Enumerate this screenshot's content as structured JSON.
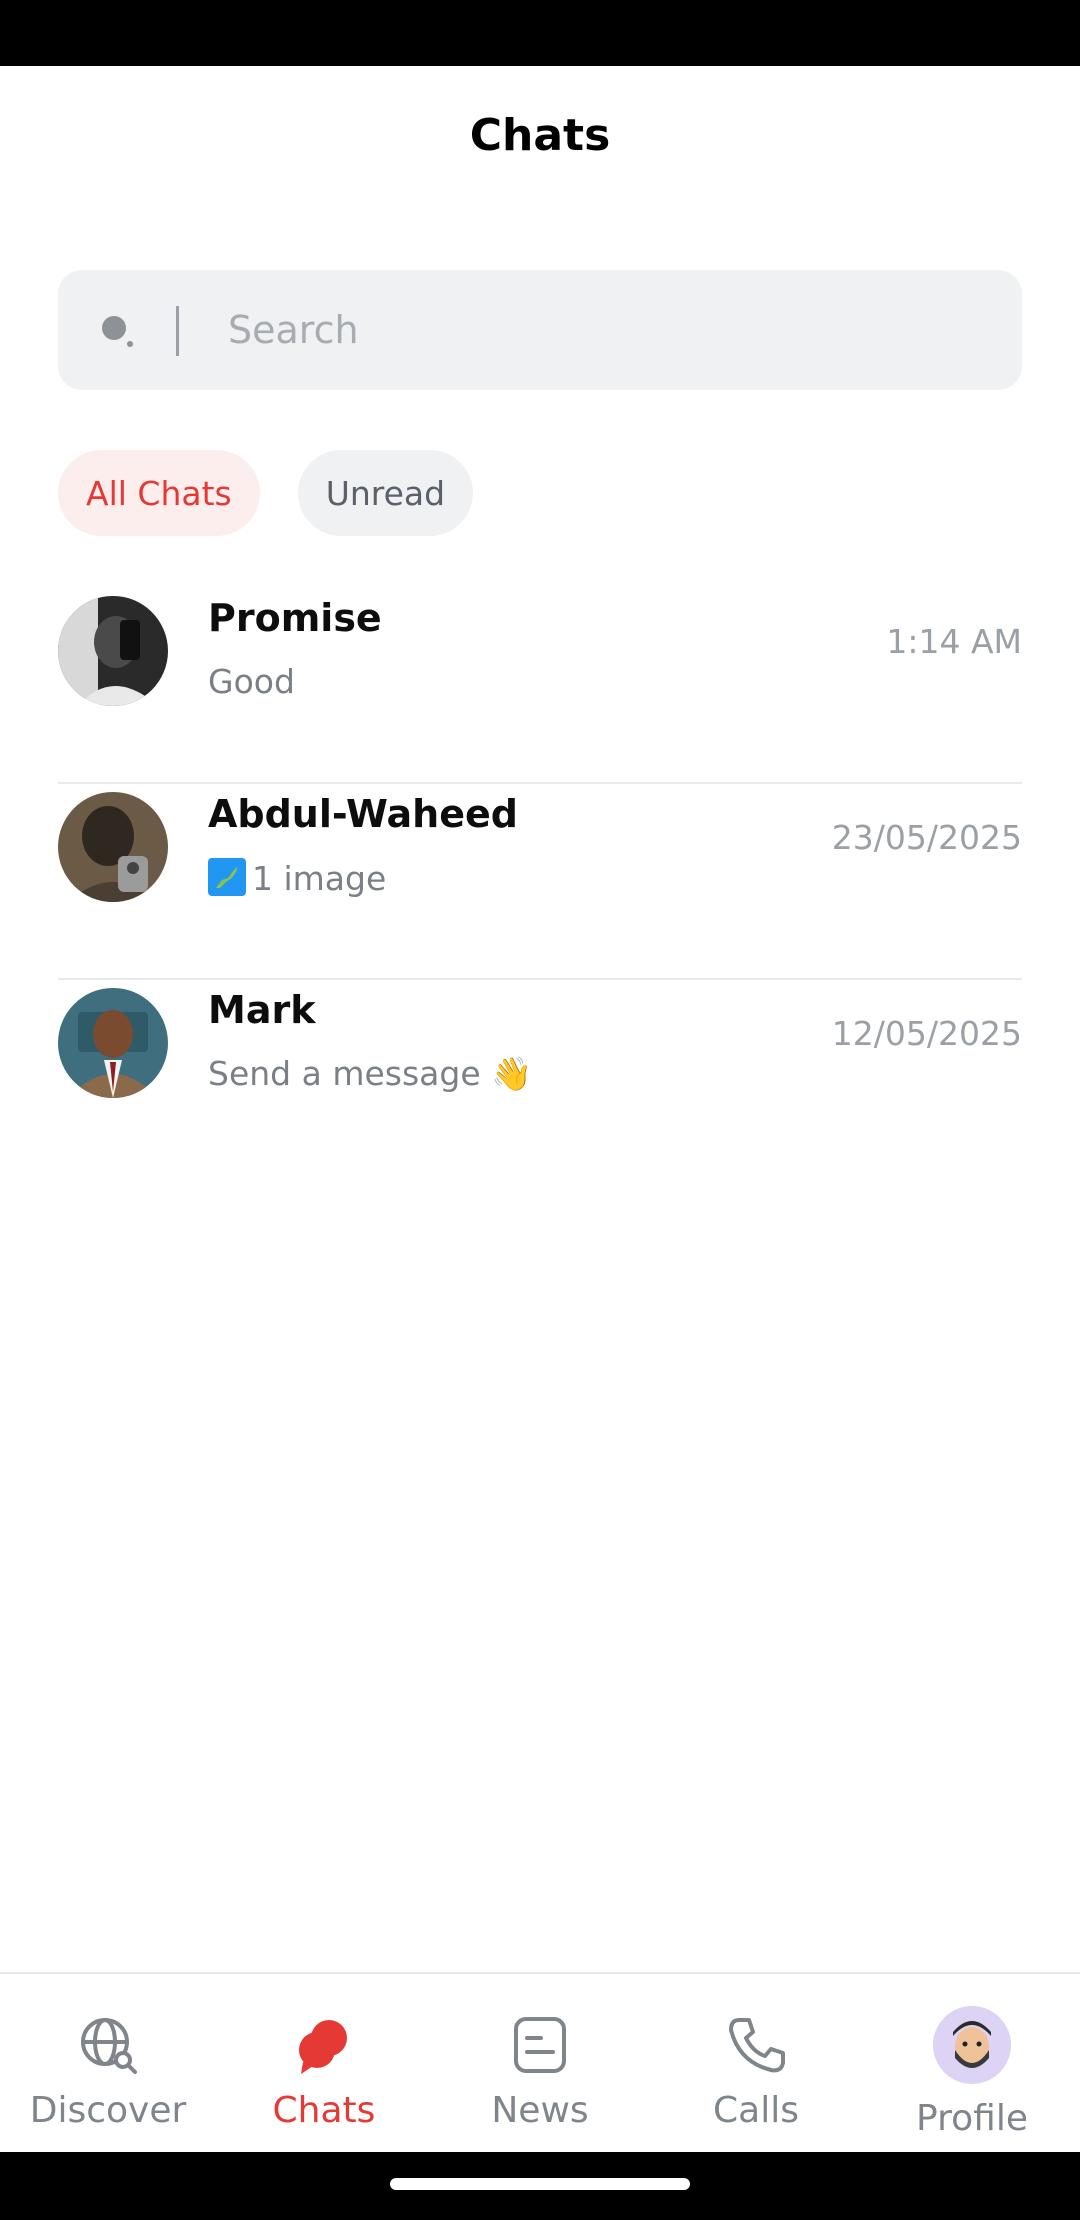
{
  "header": {
    "title": "Chats"
  },
  "search": {
    "placeholder": "Search"
  },
  "filters": [
    {
      "label": "All Chats",
      "active": true
    },
    {
      "label": "Unread",
      "active": false
    }
  ],
  "chats": [
    {
      "name": "Promise",
      "preview": "Good",
      "time": "1:14 AM"
    },
    {
      "name": "Abdul-Waheed",
      "preview": "1 image",
      "time": "23/05/2025"
    },
    {
      "name": "Mark",
      "preview": "Send a message 👋",
      "time": "12/05/2025"
    }
  ],
  "nav": [
    {
      "label": "Discover",
      "icon": "globe-search-icon"
    },
    {
      "label": "Chats",
      "icon": "chat-bubbles-icon",
      "active": true
    },
    {
      "label": "News",
      "icon": "news-icon"
    },
    {
      "label": "Calls",
      "icon": "phone-icon"
    },
    {
      "label": "Profile",
      "icon": "avatar"
    }
  ],
  "colors": {
    "accent": "#e53935",
    "muted": "#7f858b",
    "surface": "#f0f1f3"
  }
}
